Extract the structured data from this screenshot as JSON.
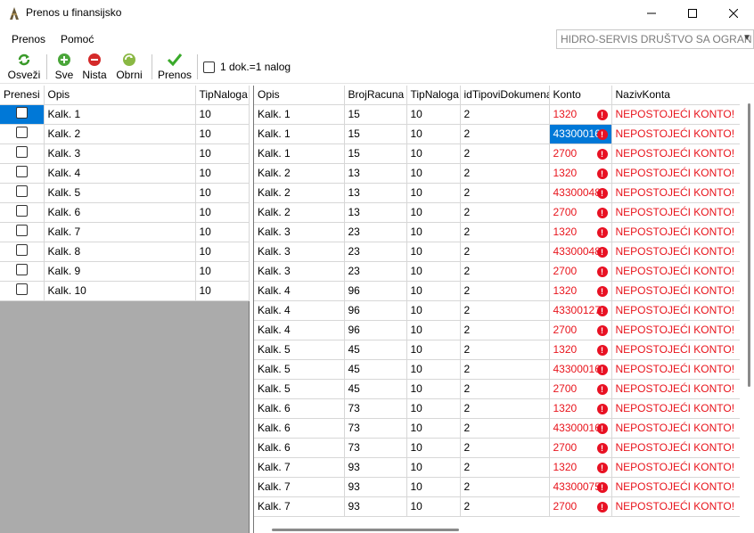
{
  "window": {
    "title": "Prenos u finansijsko"
  },
  "menu": {
    "items": [
      "Prenos",
      "Pomoć"
    ]
  },
  "company_select": {
    "value": "HIDRO-SERVIS  DRUŠTVO SA OGRAN"
  },
  "toolbar": {
    "osvezi": "Osveži",
    "sve": "Sve",
    "nista": "Nista",
    "obrni": "Obrni",
    "prenos": "Prenos",
    "dok_nalog": "1 dok.=1 nalog"
  },
  "left_grid": {
    "headers": [
      "Prenesi",
      "Opis",
      "TipNaloga"
    ],
    "rows": [
      {
        "opis": "Kalk. 1",
        "tip": "10"
      },
      {
        "opis": "Kalk. 2",
        "tip": "10"
      },
      {
        "opis": "Kalk. 3",
        "tip": "10"
      },
      {
        "opis": "Kalk. 4",
        "tip": "10"
      },
      {
        "opis": "Kalk. 5",
        "tip": "10"
      },
      {
        "opis": "Kalk. 6",
        "tip": "10"
      },
      {
        "opis": "Kalk. 7",
        "tip": "10"
      },
      {
        "opis": "Kalk. 8",
        "tip": "10"
      },
      {
        "opis": "Kalk. 9",
        "tip": "10"
      },
      {
        "opis": "Kalk. 10",
        "tip": "10"
      }
    ]
  },
  "right_grid": {
    "headers": [
      "Opis",
      "BrojRacuna",
      "TipNaloga",
      "idTipoviDokumenat",
      "Konto",
      "NazivKonta"
    ],
    "error_text": "NEPOSTOJEĆI KONTO!",
    "rows": [
      {
        "opis": "Kalk. 1",
        "broj": "15",
        "tip": "10",
        "idtip": "2",
        "konto": "1320",
        "naziv": "NEPOSTOJEĆI KONTO!"
      },
      {
        "opis": "Kalk. 1",
        "broj": "15",
        "tip": "10",
        "idtip": "2",
        "konto": "43300016",
        "naziv": "NEPOSTOJEĆI KONTO!"
      },
      {
        "opis": "Kalk. 1",
        "broj": "15",
        "tip": "10",
        "idtip": "2",
        "konto": "2700",
        "naziv": "NEPOSTOJEĆI KONTO!"
      },
      {
        "opis": "Kalk. 2",
        "broj": "13",
        "tip": "10",
        "idtip": "2",
        "konto": "1320",
        "naziv": "NEPOSTOJEĆI KONTO!"
      },
      {
        "opis": "Kalk. 2",
        "broj": "13",
        "tip": "10",
        "idtip": "2",
        "konto": "43300048",
        "naziv": "NEPOSTOJEĆI KONTO!"
      },
      {
        "opis": "Kalk. 2",
        "broj": "13",
        "tip": "10",
        "idtip": "2",
        "konto": "2700",
        "naziv": "NEPOSTOJEĆI KONTO!"
      },
      {
        "opis": "Kalk. 3",
        "broj": "23",
        "tip": "10",
        "idtip": "2",
        "konto": "1320",
        "naziv": "NEPOSTOJEĆI KONTO!"
      },
      {
        "opis": "Kalk. 3",
        "broj": "23",
        "tip": "10",
        "idtip": "2",
        "konto": "43300048",
        "naziv": "NEPOSTOJEĆI KONTO!"
      },
      {
        "opis": "Kalk. 3",
        "broj": "23",
        "tip": "10",
        "idtip": "2",
        "konto": "2700",
        "naziv": "NEPOSTOJEĆI KONTO!"
      },
      {
        "opis": "Kalk. 4",
        "broj": "96",
        "tip": "10",
        "idtip": "2",
        "konto": "1320",
        "naziv": "NEPOSTOJEĆI KONTO!"
      },
      {
        "opis": "Kalk. 4",
        "broj": "96",
        "tip": "10",
        "idtip": "2",
        "konto": "43300127",
        "naziv": "NEPOSTOJEĆI KONTO!"
      },
      {
        "opis": "Kalk. 4",
        "broj": "96",
        "tip": "10",
        "idtip": "2",
        "konto": "2700",
        "naziv": "NEPOSTOJEĆI KONTO!"
      },
      {
        "opis": "Kalk. 5",
        "broj": "45",
        "tip": "10",
        "idtip": "2",
        "konto": "1320",
        "naziv": "NEPOSTOJEĆI KONTO!"
      },
      {
        "opis": "Kalk. 5",
        "broj": "45",
        "tip": "10",
        "idtip": "2",
        "konto": "43300016",
        "naziv": "NEPOSTOJEĆI KONTO!"
      },
      {
        "opis": "Kalk. 5",
        "broj": "45",
        "tip": "10",
        "idtip": "2",
        "konto": "2700",
        "naziv": "NEPOSTOJEĆI KONTO!"
      },
      {
        "opis": "Kalk. 6",
        "broj": "73",
        "tip": "10",
        "idtip": "2",
        "konto": "1320",
        "naziv": "NEPOSTOJEĆI KONTO!"
      },
      {
        "opis": "Kalk. 6",
        "broj": "73",
        "tip": "10",
        "idtip": "2",
        "konto": "43300016",
        "naziv": "NEPOSTOJEĆI KONTO!"
      },
      {
        "opis": "Kalk. 6",
        "broj": "73",
        "tip": "10",
        "idtip": "2",
        "konto": "2700",
        "naziv": "NEPOSTOJEĆI KONTO!"
      },
      {
        "opis": "Kalk. 7",
        "broj": "93",
        "tip": "10",
        "idtip": "2",
        "konto": "1320",
        "naziv": "NEPOSTOJEĆI KONTO!"
      },
      {
        "opis": "Kalk. 7",
        "broj": "93",
        "tip": "10",
        "idtip": "2",
        "konto": "43300075",
        "naziv": "NEPOSTOJEĆI KONTO!"
      },
      {
        "opis": "Kalk. 7",
        "broj": "93",
        "tip": "10",
        "idtip": "2",
        "konto": "2700",
        "naziv": "NEPOSTOJEĆI KONTO!"
      }
    ]
  },
  "colors": {
    "selection": "#0078d7",
    "error_red": "#e8141c",
    "grid_empty": "#ababab"
  }
}
